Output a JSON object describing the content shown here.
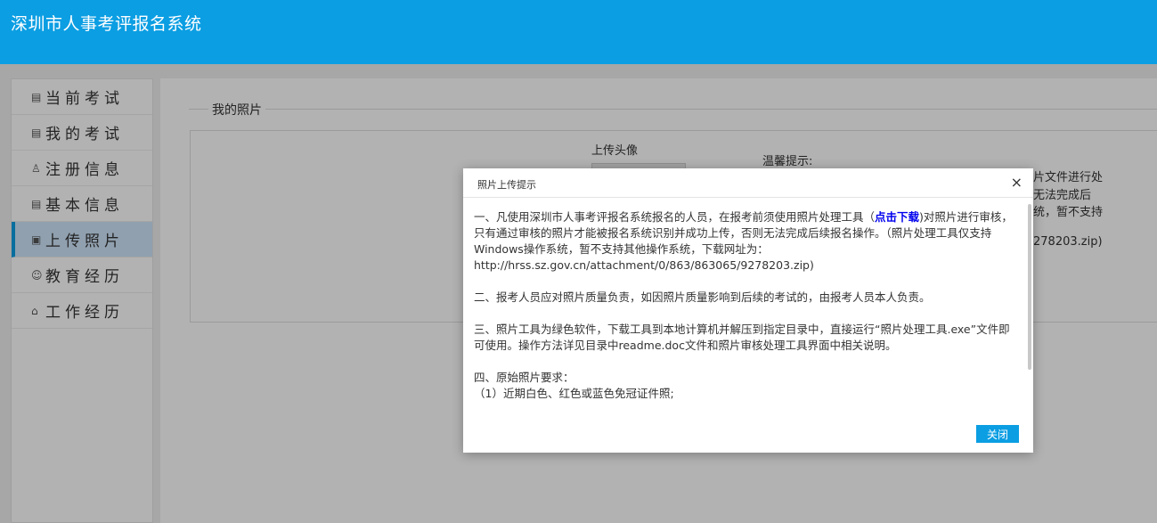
{
  "header": {
    "title": "深圳市人事考评报名系统"
  },
  "sidebar": {
    "items": [
      {
        "icon": "▤",
        "label": "当前考试",
        "active": false
      },
      {
        "icon": "▤",
        "label": "我的考试",
        "active": false
      },
      {
        "icon": "♙",
        "label": "注册信息",
        "active": false
      },
      {
        "icon": "▤",
        "label": "基本信息",
        "active": false
      },
      {
        "icon": "▣",
        "label": "上传照片",
        "active": true
      },
      {
        "icon": "☺",
        "label": "教育经历",
        "active": false
      },
      {
        "icon": "⌂",
        "label": "工作经历",
        "active": false
      }
    ]
  },
  "main": {
    "legend": "我的照片",
    "upload_label": "上传头像",
    "tips_title": "温馨提示:",
    "tips_lines": [
      "片文件进行处",
      "无法完成后",
      "统，暂不支持",
      "278203.zip)"
    ]
  },
  "dialog": {
    "title": "照片上传提示",
    "close_icon": "×",
    "p1_before": "一、凡使用深圳市人事考评报名系统报名的人员，在报考前须使用照片处理工具（",
    "p1_link": "点击下载",
    "p1_after": ")对照片进行审核，只有通过审核的照片才能被报名系统识别并成功上传，否则无法完成后续报名操作。（照片处理工具仅支持Windows操作系统，暂不支持其他操作系统，下载网址为：http://hrss.sz.gov.cn/attachment/0/863/863065/9278203.zip)",
    "p2": "二、报考人员应对照片质量负责，如因照片质量影响到后续的考试的，由报考人员本人负责。",
    "p3": "三、照片工具为绿色软件，下载工具到本地计算机并解压到指定目录中，直接运行“照片处理工具.exe”文件即可使用。操作方法详见目录中readme.doc文件和照片审核处理工具界面中相关说明。",
    "p4_title": "四、原始照片要求：",
    "p4_item1": "（1）近期白色、红色或蓝色免冠证件照;",
    "close_button": "关闭"
  },
  "colors": {
    "accent": "#0b9ee3",
    "active_bg": "#cfe6fb"
  }
}
